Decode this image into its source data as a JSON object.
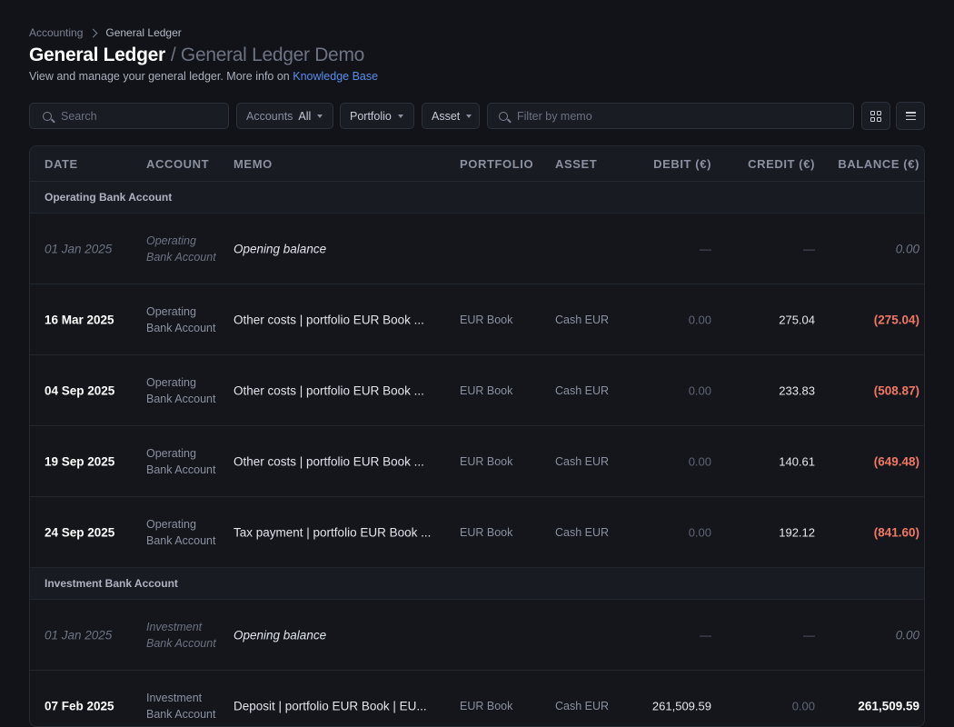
{
  "breadcrumb": {
    "parent": "Accounting",
    "current": "General Ledger"
  },
  "header": {
    "title": "General Ledger",
    "subtitle": "/ General Ledger Demo",
    "description": "View and manage your general ledger. More info on",
    "link_text": "Knowledge Base"
  },
  "toolbar": {
    "search_placeholder": "Search",
    "accounts_label": "Accounts",
    "accounts_value": "All",
    "portfolio_label": "Portfolio",
    "asset_label": "Asset",
    "memo_placeholder": "Filter by memo",
    "icons": [
      "grid-view-icon",
      "list-view-icon"
    ]
  },
  "table": {
    "columns": [
      "DATE",
      "ACCOUNT",
      "MEMO",
      "PORTFOLIO",
      "ASSET",
      "DEBIT (€)",
      "CREDIT (€)",
      "BALANCE (€)"
    ],
    "groups": [
      {
        "name": "Operating Bank Account",
        "rows": [
          {
            "date": "01 Jan 2025",
            "account": "Operating Bank Account",
            "memo": "Opening balance",
            "portfolio": "",
            "asset": "",
            "debit": "—",
            "credit": "—",
            "balance": "0.00",
            "opening": true
          },
          {
            "date": "16 Mar 2025",
            "account": "Operating Bank Account",
            "memo": "Other costs | portfolio EUR Book ...",
            "portfolio": "EUR Book",
            "asset": "Cash EUR",
            "debit": "0.00",
            "credit": "275.04",
            "balance": "(275.04)"
          },
          {
            "date": "04 Sep 2025",
            "account": "Operating Bank Account",
            "memo": "Other costs | portfolio EUR Book ...",
            "portfolio": "EUR Book",
            "asset": "Cash EUR",
            "debit": "0.00",
            "credit": "233.83",
            "balance": "(508.87)"
          },
          {
            "date": "19 Sep 2025",
            "account": "Operating Bank Account",
            "memo": "Other costs | portfolio EUR Book ...",
            "portfolio": "EUR Book",
            "asset": "Cash EUR",
            "debit": "0.00",
            "credit": "140.61",
            "balance": "(649.48)"
          },
          {
            "date": "24 Sep 2025",
            "account": "Operating Bank Account",
            "memo": "Tax payment | portfolio EUR Book ...",
            "portfolio": "EUR Book",
            "asset": "Cash EUR",
            "debit": "0.00",
            "credit": "192.12",
            "balance": "(841.60)"
          }
        ]
      },
      {
        "name": "Investment Bank Account",
        "rows": [
          {
            "date": "01 Jan 2025",
            "account": "Investment Bank Account",
            "memo": "Opening balance",
            "portfolio": "",
            "asset": "",
            "debit": "—",
            "credit": "—",
            "balance": "0.00",
            "opening": true
          },
          {
            "date": "07 Feb 2025",
            "account": "Investment Bank Account",
            "memo": "Deposit | portfolio EUR Book | EU...",
            "portfolio": "EUR Book",
            "asset": "Cash EUR",
            "debit": "261,509.59",
            "credit": "0.00",
            "balance": "261,509.59"
          }
        ]
      }
    ]
  },
  "colors": {
    "negative": "#f07864",
    "link": "#5a8dee",
    "background": "#111318"
  }
}
